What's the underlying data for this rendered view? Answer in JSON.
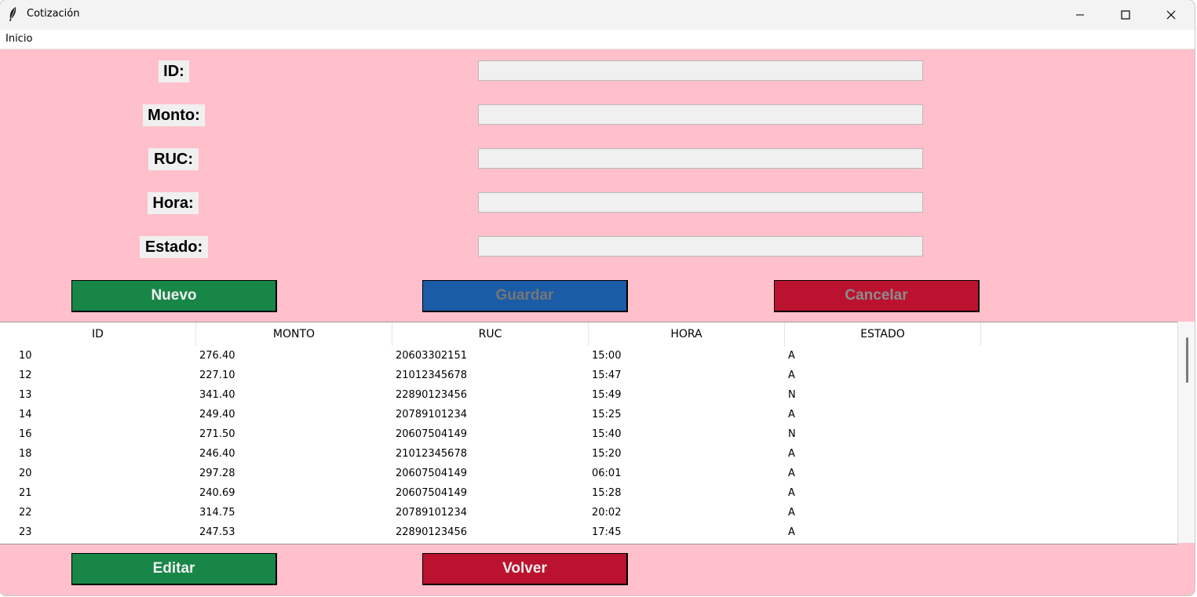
{
  "window": {
    "title": "Cotización"
  },
  "menu": {
    "items": [
      "Inicio"
    ]
  },
  "form": {
    "fields": [
      {
        "label": "ID:",
        "value": ""
      },
      {
        "label": "Monto:",
        "value": ""
      },
      {
        "label": "RUC:",
        "value": ""
      },
      {
        "label": "Hora:",
        "value": ""
      },
      {
        "label": "Estado:",
        "value": ""
      }
    ]
  },
  "buttons": {
    "nuevo": "Nuevo",
    "guardar": "Guardar",
    "cancelar": "Cancelar",
    "editar": "Editar",
    "volver": "Volver"
  },
  "table": {
    "columns": [
      "ID",
      "MONTO",
      "RUC",
      "HORA",
      "ESTADO"
    ],
    "rows": [
      [
        "10",
        "276.40",
        "20603302151",
        "15:00",
        "A"
      ],
      [
        "12",
        "227.10",
        "21012345678",
        "15:47",
        "A"
      ],
      [
        "13",
        "341.40",
        "22890123456",
        "15:49",
        "N"
      ],
      [
        "14",
        "249.40",
        "20789101234",
        "15:25",
        "A"
      ],
      [
        "16",
        "271.50",
        "20607504149",
        "15:40",
        "N"
      ],
      [
        "18",
        "246.40",
        "21012345678",
        "15:20",
        "A"
      ],
      [
        "20",
        "297.28",
        "20607504149",
        "06:01",
        "A"
      ],
      [
        "21",
        "240.69",
        "20607504149",
        "15:28",
        "A"
      ],
      [
        "22",
        "314.75",
        "20789101234",
        "20:02",
        "A"
      ],
      [
        "23",
        "247.53",
        "22890123456",
        "17:45",
        "A"
      ]
    ]
  },
  "colors": {
    "background": "#ffc0cb",
    "green": "#188647",
    "blue": "#1b5ca7",
    "red": "#bb132f"
  }
}
